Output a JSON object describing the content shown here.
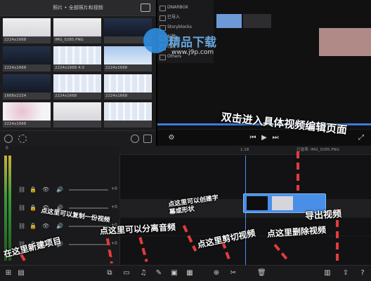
{
  "browser": {
    "title": "照片 • 全部照片和视频",
    "thumbs": [
      {
        "caption": "2224x1668",
        "style": "light"
      },
      {
        "caption": "IMG_0285.PNG",
        "style": "light"
      },
      {
        "caption": "",
        "style": "dark"
      },
      {
        "caption": "2224x1668",
        "style": "dark"
      },
      {
        "caption": "2224x1668  4:3",
        "style": "grid"
      },
      {
        "caption": "2224x1668",
        "style": "sky"
      },
      {
        "caption": "1668x2224",
        "style": "dark"
      },
      {
        "caption": "2224x1668",
        "style": "grid"
      },
      {
        "caption": "2224x1668",
        "style": "grid"
      },
      {
        "caption": "2224x1668",
        "style": "pink"
      },
      {
        "caption": "",
        "style": "light"
      },
      {
        "caption": "",
        "style": "grid"
      }
    ]
  },
  "preview": {
    "library": [
      "DNARBOX",
      "已导入",
      "Storyblocks",
      "标题",
      "过渡",
      "Others"
    ],
    "project_label": "已选项: IMG_0285.PNG"
  },
  "timeline": {
    "ruler_left": "0",
    "ruler_mark": "1.18",
    "level_labels": [
      "+0",
      "+0",
      "+0",
      "+0"
    ]
  },
  "watermark": {
    "logo_text": "精品下载",
    "url": "www.j9p.com"
  },
  "annotations": {
    "enter_edit": "双击进入具体视频编辑页面",
    "export": "导出视频",
    "copy": "点这里可以复制一份视频",
    "split_audio": "点这里可以分离音频",
    "subtitle": "点这里可以创建字幕或形状",
    "cut": "点这里剪切视频",
    "delete": "点这里删除视频",
    "new_project": "在这里新建项目"
  },
  "colors": {
    "accent": "#4b8ff2",
    "annotation_dash": "#e43b3b",
    "clip": "#4a8fe7"
  }
}
